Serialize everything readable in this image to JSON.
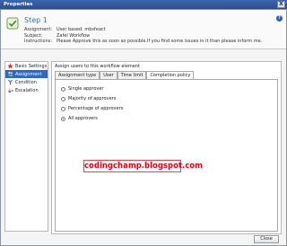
{
  "window": {
    "title": "Properties",
    "close_label": "X"
  },
  "header": {
    "step_title": "Step 1",
    "assignment_key": "Assignment:",
    "assignment_val": "User based: mbsfeact",
    "subject_key": "Subject:",
    "subject_val": "Zafel Workflow",
    "instructions_key": "Instructions:",
    "instructions_val": "Please Approve this as soon as possible.If you find some issues in it than please inform me.",
    "help_label": "?"
  },
  "sidebar": {
    "items": [
      {
        "label": "Basic Settings",
        "icon": "star-icon"
      },
      {
        "label": "Assignment",
        "icon": "people-icon"
      },
      {
        "label": "Condition",
        "icon": "fork-icon"
      },
      {
        "label": "Escalation",
        "icon": "escalation-icon"
      }
    ]
  },
  "content": {
    "heading": "Assign users to this workflow element",
    "tabs": [
      {
        "label": "Assignment type"
      },
      {
        "label": "User"
      },
      {
        "label": "Time limit"
      },
      {
        "label": "Completion policy"
      }
    ],
    "options": [
      {
        "label": "Single approver",
        "checked": false
      },
      {
        "label": "Majority of approvers",
        "checked": false
      },
      {
        "label": "Percentage of approvers",
        "checked": false
      },
      {
        "label": "All approvers",
        "checked": true
      }
    ]
  },
  "watermark": {
    "text": "codingchamp.blogspot.com"
  },
  "footer": {
    "close_label": "Close"
  }
}
